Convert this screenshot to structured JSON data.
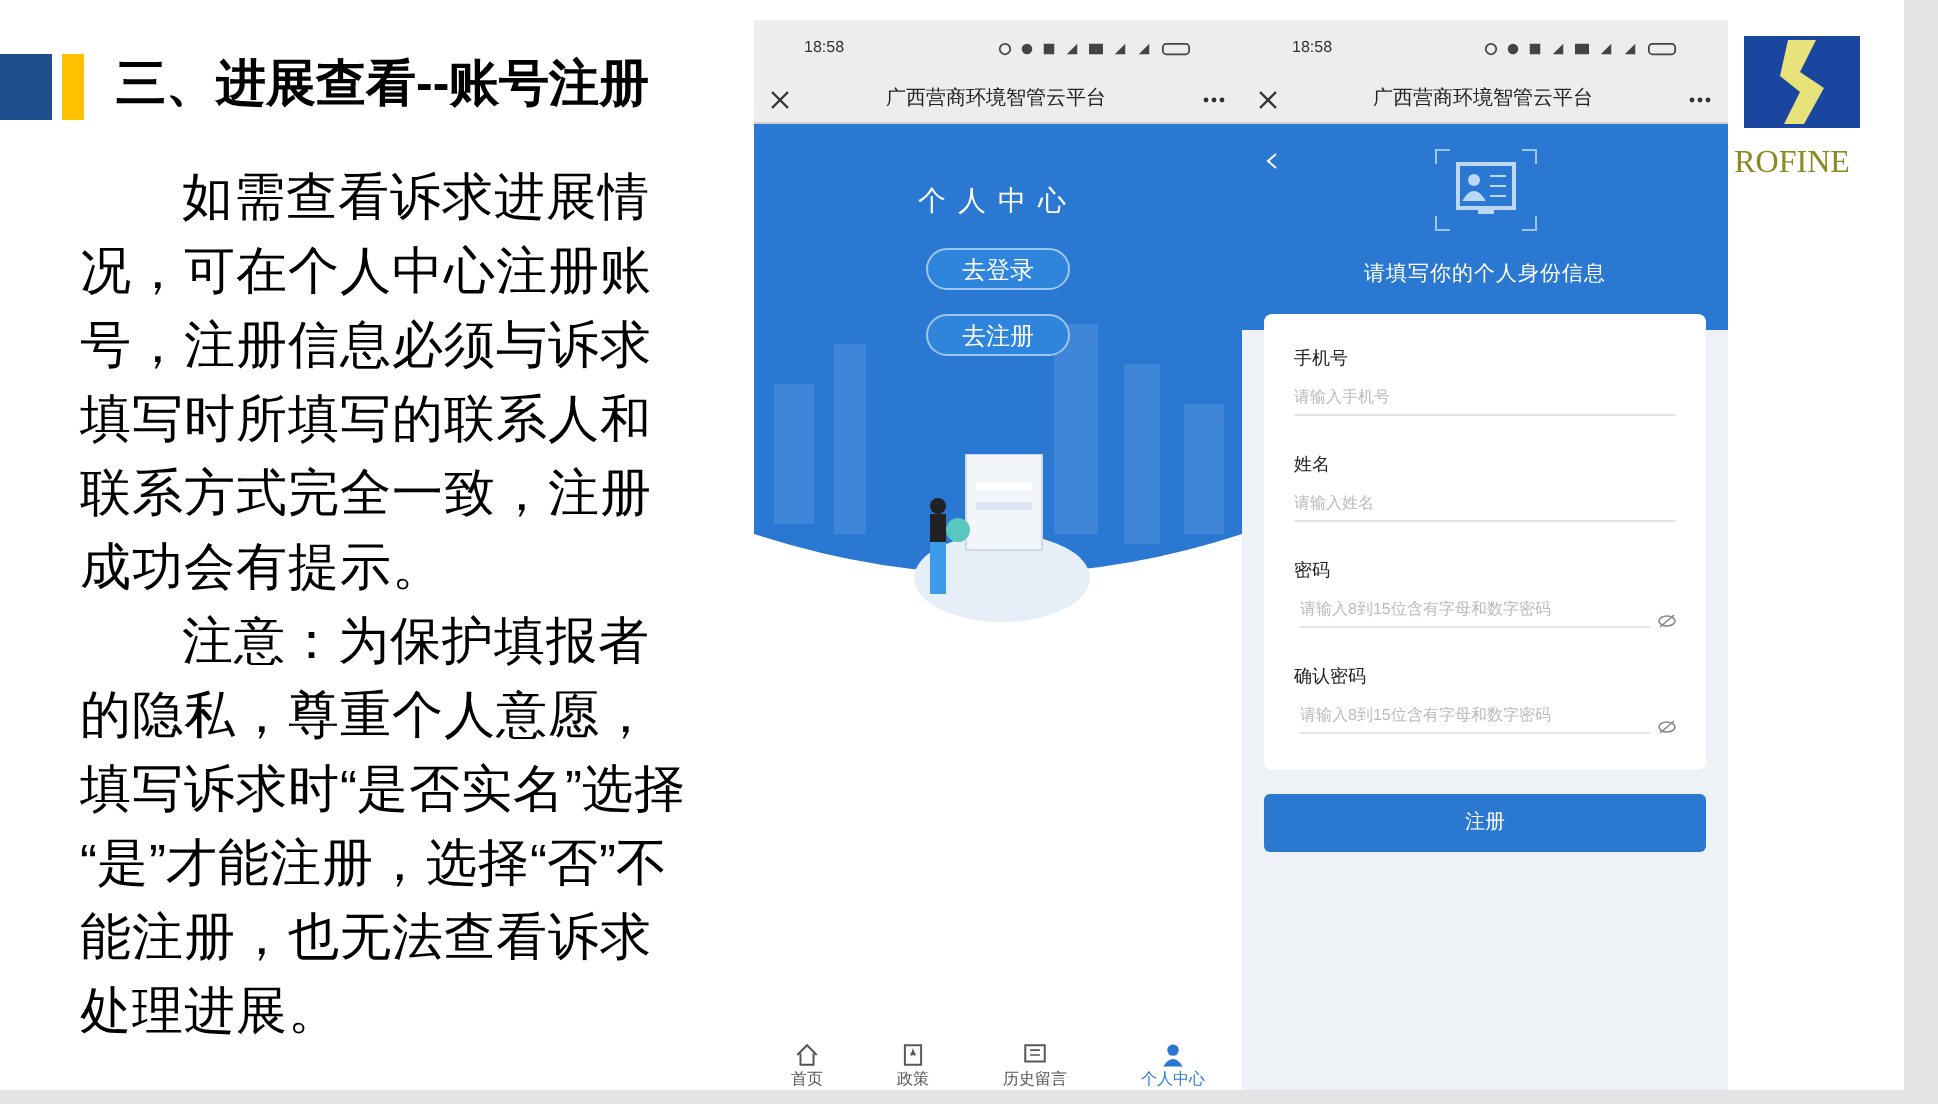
{
  "slide": {
    "title": "三、进展查看--账号注册",
    "paragraphs": [
      "如需查看诉求进展情况，可在个人中心注册账号，注册信息必须与诉求填写时所填写的联系人和联系方式完全一致，注册成功会有提示。",
      "注意：为保护填报者的隐私，尊重个人意愿，填写诉求时“是否实名”选择“是”才能注册，选择“否”不能注册，也无法查看诉求处理进展。"
    ],
    "logo_text": "ROFINE"
  },
  "phone_1": {
    "status_time": "18:58",
    "title": "广西营商环境智管云平台",
    "heading": "个人中心",
    "buttons": [
      "去登录",
      "去注册"
    ],
    "nav": [
      {
        "label": "首页",
        "selected": false,
        "kind": "home"
      },
      {
        "label": "政策",
        "selected": false,
        "kind": "policy"
      },
      {
        "label": "历史留言",
        "selected": false,
        "kind": "message"
      },
      {
        "label": "个人中心",
        "selected": true,
        "kind": "user"
      }
    ]
  },
  "phone_2": {
    "status_time": "18:58",
    "title": "广西营商环境智管云平台",
    "heading": "请填写你的个人身份信息",
    "fields": [
      {
        "label": "手机号",
        "placeholder": "请输入手机号",
        "kind": "text"
      },
      {
        "label": "姓名",
        "placeholder": "请输入姓名",
        "kind": "text"
      },
      {
        "label": "密码",
        "placeholder": "请输入8到15位含有字母和数字密码",
        "kind": "password"
      },
      {
        "label": "确认密码",
        "placeholder": "请输入8到15位含有字母和数字密码",
        "kind": "password"
      }
    ],
    "submit": "注册"
  }
}
